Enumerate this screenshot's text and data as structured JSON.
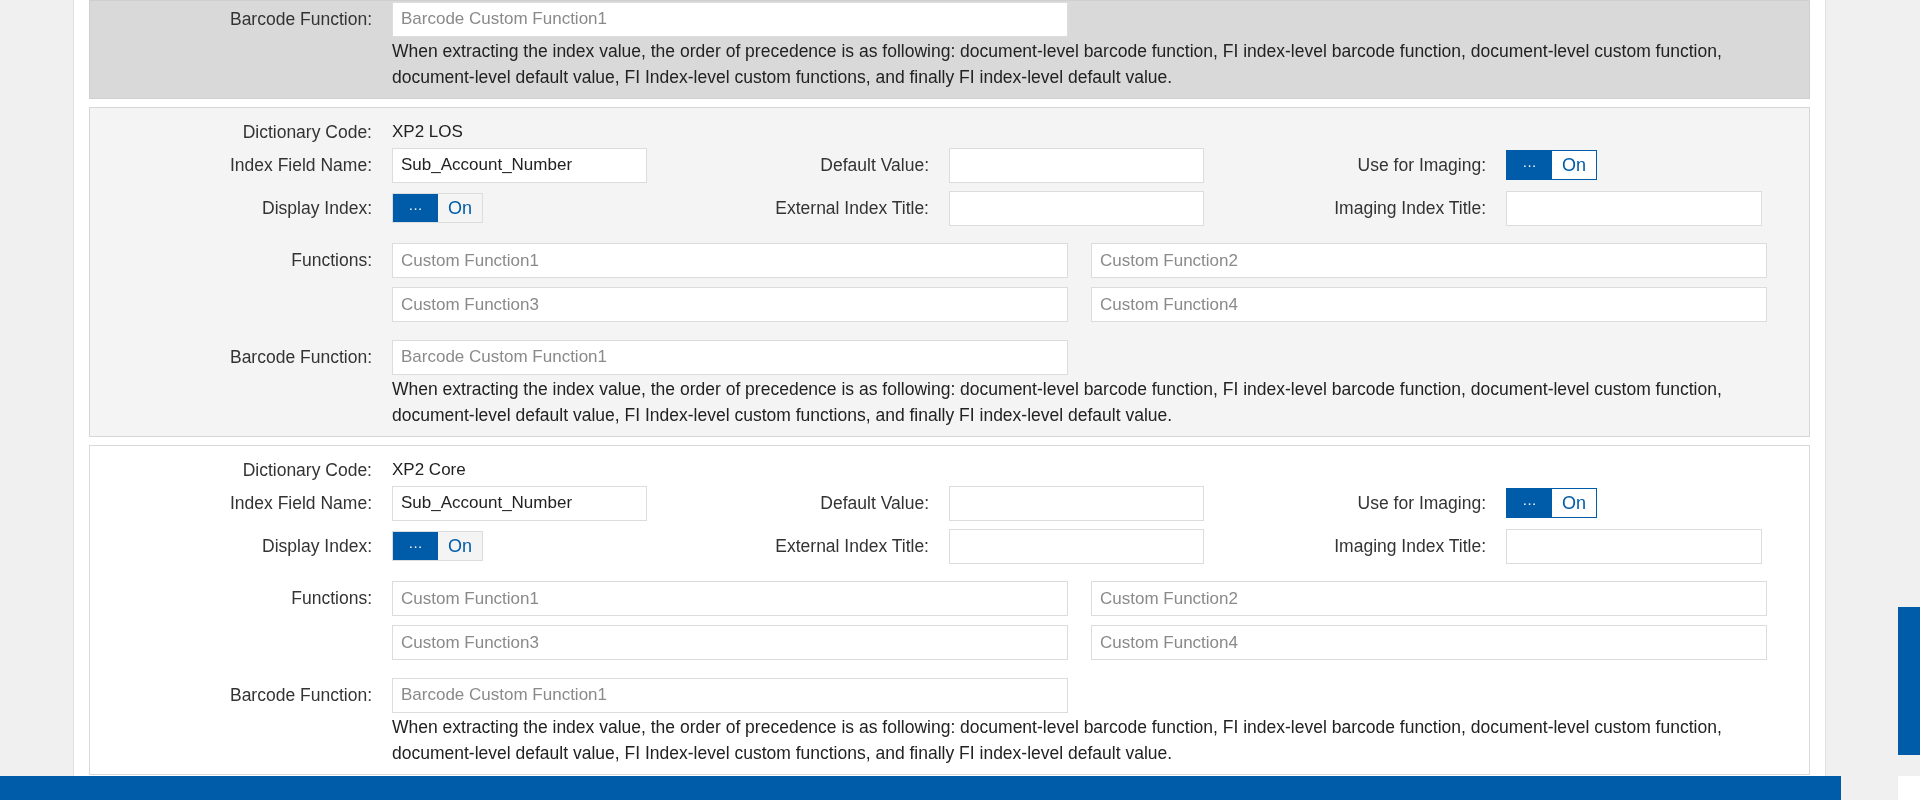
{
  "sections": [
    {
      "selected": true,
      "barcode": {
        "label": "Barcode Function:",
        "placeholder": "Barcode Custom Function1"
      },
      "note": "When extracting the index value, the order of precedence is as following: document-level barcode function, FI index-level barcode function, document-level custom function, document-level default value, FI Index-level custom functions, and finally FI index-level default value."
    },
    {
      "selected": false,
      "dictionary": {
        "label": "Dictionary Code:",
        "value": "XP2 LOS"
      },
      "index_field": {
        "label": "Index Field Name:",
        "value": "Sub_Account_Number"
      },
      "default_value": {
        "label": "Default Value:"
      },
      "use_for_imaging": {
        "label": "Use for Imaging:",
        "handle": "···",
        "text": "On",
        "on": true
      },
      "display_index": {
        "label": "Display Index:",
        "handle": "···",
        "text": "On",
        "on": true
      },
      "external_title": {
        "label": "External Index Title:"
      },
      "imaging_title": {
        "label": "Imaging Index Title:"
      },
      "functions": {
        "label": "Functions:",
        "placeholders": [
          "Custom Function1",
          "Custom Function2",
          "Custom Function3",
          "Custom Function4"
        ]
      },
      "barcode": {
        "label": "Barcode Function:",
        "placeholder": "Barcode Custom Function1"
      },
      "note": "When extracting the index value, the order of precedence is as following: document-level barcode function, FI index-level barcode function, document-level custom function, document-level default value, FI Index-level custom functions, and finally FI index-level default value."
    },
    {
      "selected": false,
      "dictionary": {
        "label": "Dictionary Code:",
        "value": "XP2 Core"
      },
      "index_field": {
        "label": "Index Field Name:",
        "value": "Sub_Account_Number"
      },
      "default_value": {
        "label": "Default Value:"
      },
      "use_for_imaging": {
        "label": "Use for Imaging:",
        "handle": "···",
        "text": "On",
        "on": true
      },
      "display_index": {
        "label": "Display Index:",
        "handle": "···",
        "text": "On",
        "on": true
      },
      "external_title": {
        "label": "External Index Title:"
      },
      "imaging_title": {
        "label": "Imaging Index Title:"
      },
      "functions": {
        "label": "Functions:",
        "placeholders": [
          "Custom Function1",
          "Custom Function2",
          "Custom Function3",
          "Custom Function4"
        ]
      },
      "barcode": {
        "label": "Barcode Function:",
        "placeholder": "Barcode Custom Function1"
      },
      "note": "When extracting the index value, the order of precedence is as following: document-level barcode function, FI index-level barcode function, document-level custom function, document-level default value, FI Index-level custom functions, and finally FI index-level default value."
    }
  ]
}
